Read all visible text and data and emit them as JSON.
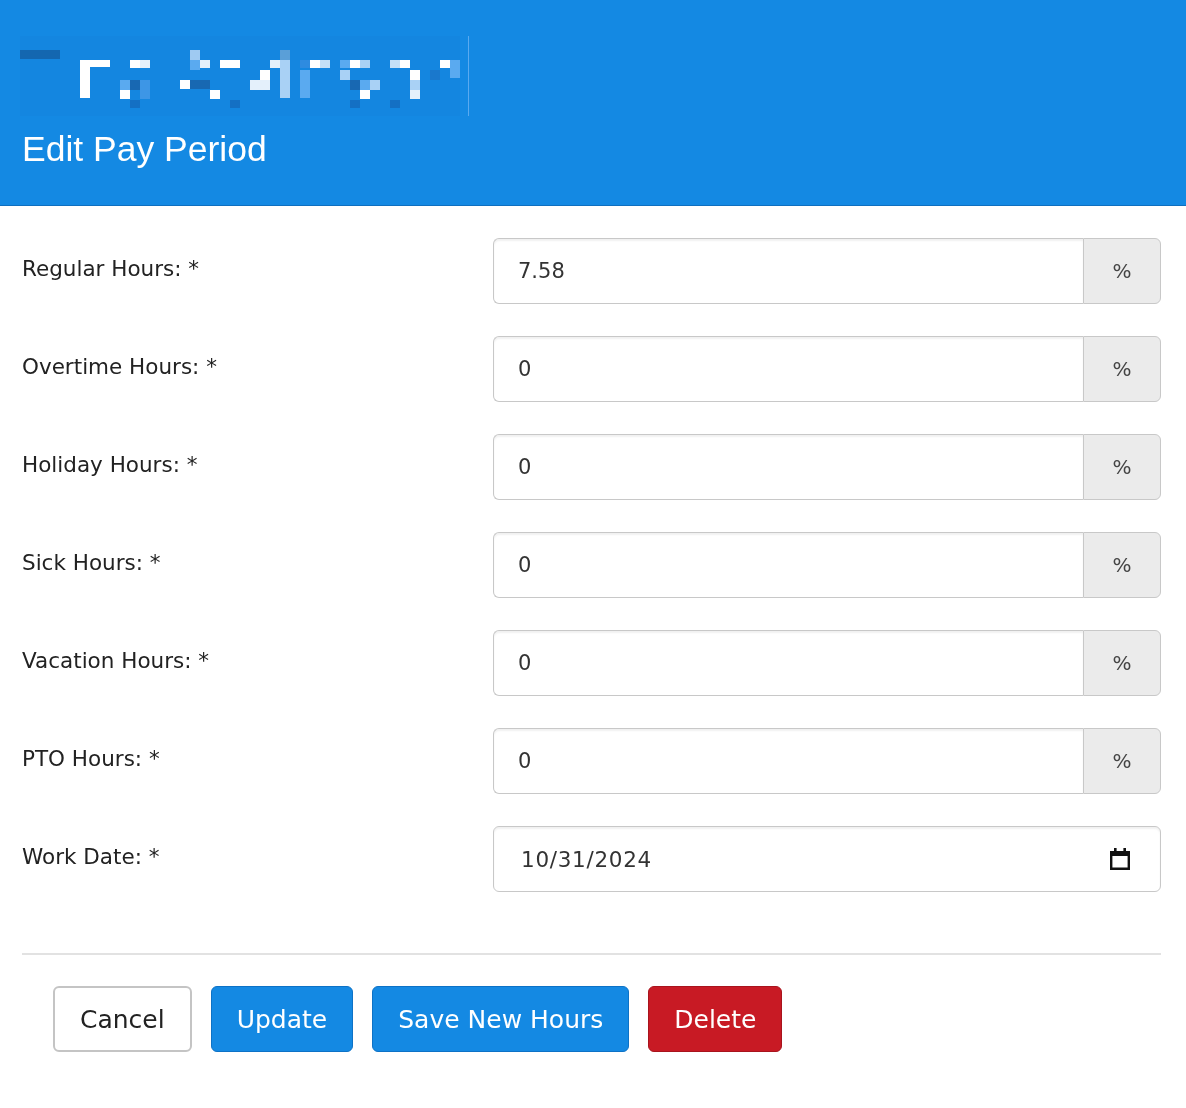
{
  "header": {
    "title": "Edit Pay Period"
  },
  "fields": [
    {
      "kind": "number",
      "label": "Regular Hours: *",
      "value": "7.58",
      "addon": "%"
    },
    {
      "kind": "number",
      "label": "Overtime Hours: *",
      "value": "0",
      "addon": "%"
    },
    {
      "kind": "number",
      "label": "Holiday Hours: *",
      "value": "0",
      "addon": "%"
    },
    {
      "kind": "number",
      "label": "Sick Hours: *",
      "value": "0",
      "addon": "%"
    },
    {
      "kind": "number",
      "label": "Vacation Hours: *",
      "value": "0",
      "addon": "%"
    },
    {
      "kind": "number",
      "label": "PTO Hours: *",
      "value": "0",
      "addon": "%"
    },
    {
      "kind": "date",
      "label": "Work Date: *",
      "value": "10/31/2024"
    }
  ],
  "buttons": [
    {
      "label": "Cancel",
      "kind": "default"
    },
    {
      "label": "Update",
      "kind": "primary"
    },
    {
      "label": "Save New Hours",
      "kind": "primary"
    },
    {
      "label": "Delete",
      "kind": "danger"
    }
  ]
}
